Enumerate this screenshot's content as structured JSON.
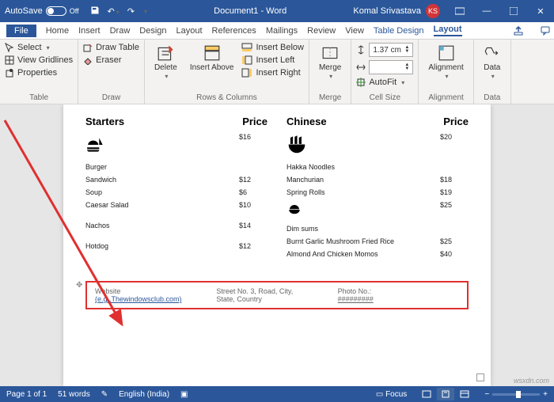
{
  "titlebar": {
    "autosave": "AutoSave",
    "autosave_state": "Off",
    "doc": "Document1 - Word",
    "user": "Komal Srivastava",
    "initials": "KS"
  },
  "tabs": {
    "file": "File",
    "items": [
      "Home",
      "Insert",
      "Draw",
      "Design",
      "Layout",
      "References",
      "Mailings",
      "Review",
      "View"
    ],
    "context": [
      "Table Design",
      "Layout"
    ],
    "active": "Layout"
  },
  "ribbon": {
    "table": {
      "select": "Select",
      "gridlines": "View Gridlines",
      "properties": "Properties",
      "label": "Table"
    },
    "draw": {
      "draw": "Draw Table",
      "eraser": "Eraser",
      "label": "Draw"
    },
    "rowscols": {
      "delete": "Delete",
      "insert_above": "Insert Above",
      "insert_below": "Insert Below",
      "insert_left": "Insert Left",
      "insert_right": "Insert Right",
      "label": "Rows & Columns"
    },
    "merge": {
      "merge": "Merge",
      "label": "Merge"
    },
    "cellsize": {
      "height": "1.37 cm",
      "autofit": "AutoFit",
      "label": "Cell Size"
    },
    "alignment": {
      "alignment": "Alignment",
      "label": "Alignment"
    },
    "data": {
      "data": "Data",
      "label": "Data"
    }
  },
  "doc": {
    "col1": {
      "head_name": "Starters",
      "head_price": "Price",
      "rows": [
        {
          "n": "Burger",
          "p": "$16"
        },
        {
          "n": "Sandwich",
          "p": "$12"
        },
        {
          "n": "Soup",
          "p": "$6"
        },
        {
          "n": "Caesar Salad",
          "p": "$10"
        },
        {
          "n": "Nachos",
          "p": "$14"
        },
        {
          "n": "Hotdog",
          "p": "$12"
        }
      ]
    },
    "col2": {
      "head_name": "Chinese",
      "head_price": "Price",
      "rows": [
        {
          "n": "Hakka Noodles",
          "p": "$20"
        },
        {
          "n": "Manchurian",
          "p": "$18"
        },
        {
          "n": "Spring Rolls",
          "p": "$19"
        },
        {
          "n": "Dim sums",
          "p": "$25"
        },
        {
          "n": "Burnt Garlic Mushroom Fried Rice",
          "p": "$25"
        },
        {
          "n": "Almond And Chicken Momos",
          "p": "$40"
        }
      ]
    },
    "footer": {
      "website": "Website",
      "link": "(e.g.,Thewindowsclub.com)",
      "address_l1": "Street No. 3, Road, City,",
      "address_l2": "State, Country",
      "photo_label": "Photo No.:",
      "photo_val": "#########"
    }
  },
  "status": {
    "page": "Page 1 of 1",
    "words": "51 words",
    "lang": "English (India)",
    "focus": "Focus",
    "zoom": "+"
  },
  "watermark": "wsxdn.com"
}
